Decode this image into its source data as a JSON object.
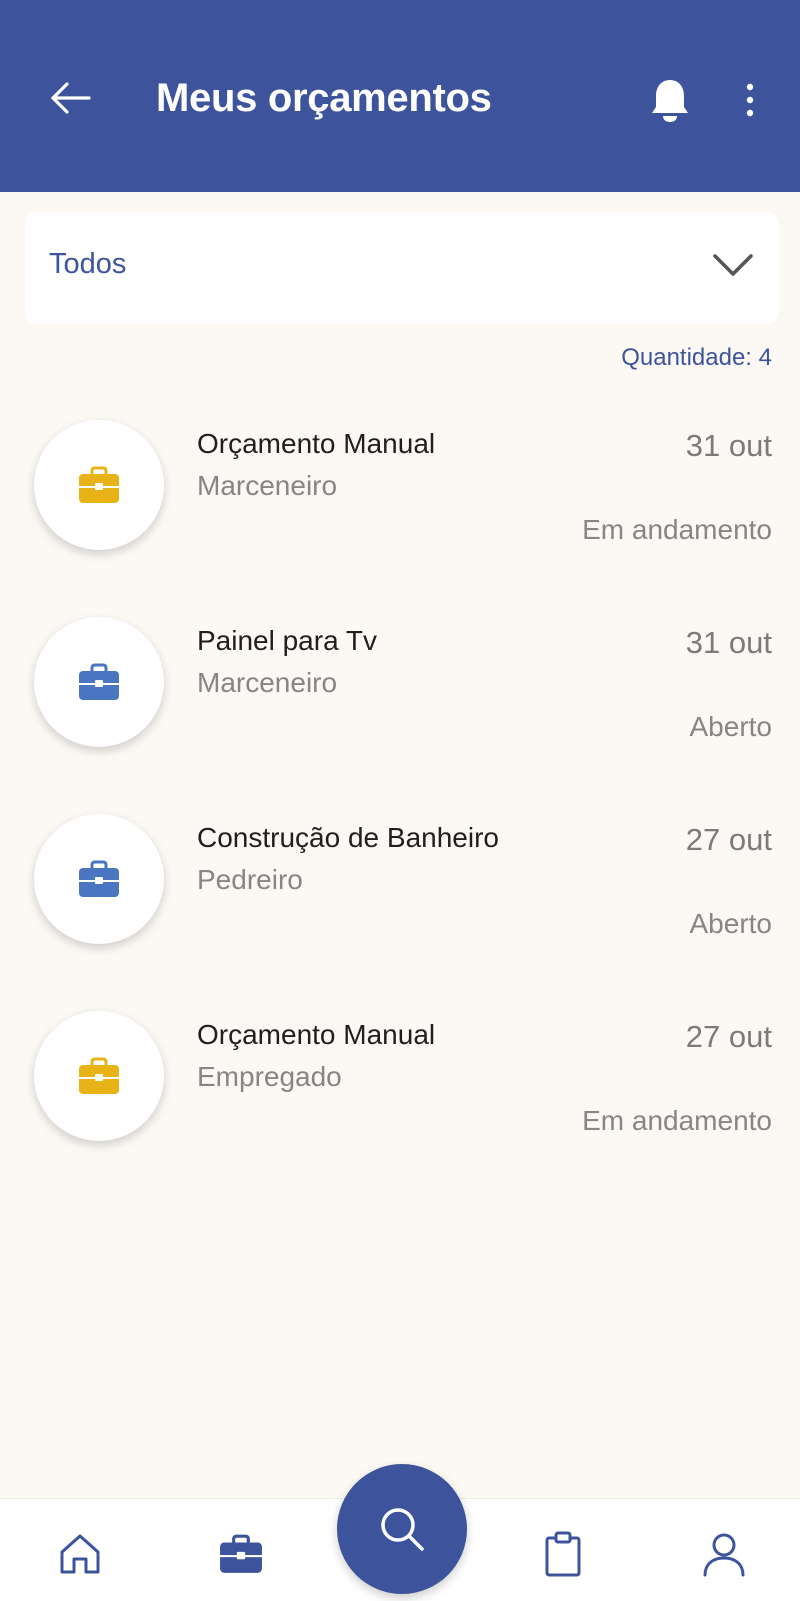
{
  "header": {
    "title": "Meus orçamentos",
    "back_icon": "arrow-left-icon",
    "notification_icon": "bell-icon",
    "menu_icon": "more-vertical-icon"
  },
  "filter": {
    "selected": "Todos",
    "icon": "chevron-down-icon"
  },
  "quantity_label": "Quantidade: 4",
  "budgets": [
    {
      "title": "Orçamento Manual",
      "category": "Marceneiro",
      "date": "31 out",
      "status": "Em andamento",
      "icon": "briefcase-icon",
      "icon_color": "#e7b317"
    },
    {
      "title": "Painel para Tv",
      "category": "Marceneiro",
      "date": "31 out",
      "status": "Aberto",
      "icon": "briefcase-icon",
      "icon_color": "#4a75c0"
    },
    {
      "title": "Construção de Banheiro",
      "category": "Pedreiro",
      "date": "27 out",
      "status": "Aberto",
      "icon": "briefcase-icon",
      "icon_color": "#4a75c0"
    },
    {
      "title": "Orçamento Manual",
      "category": "Empregado",
      "date": "27 out",
      "status": "Em andamento",
      "icon": "briefcase-icon",
      "icon_color": "#e7b317"
    }
  ],
  "bottom_nav": [
    {
      "name": "home",
      "icon": "home-icon"
    },
    {
      "name": "budgets",
      "icon": "briefcase-icon",
      "active": true
    },
    {
      "name": "search",
      "icon": "search-icon"
    },
    {
      "name": "clipboard",
      "icon": "clipboard-icon"
    },
    {
      "name": "profile",
      "icon": "user-icon"
    }
  ],
  "colors": {
    "primary": "#3d549c",
    "background": "#fcf9f5",
    "in_progress": "#e7b317",
    "open": "#4a75c0"
  }
}
